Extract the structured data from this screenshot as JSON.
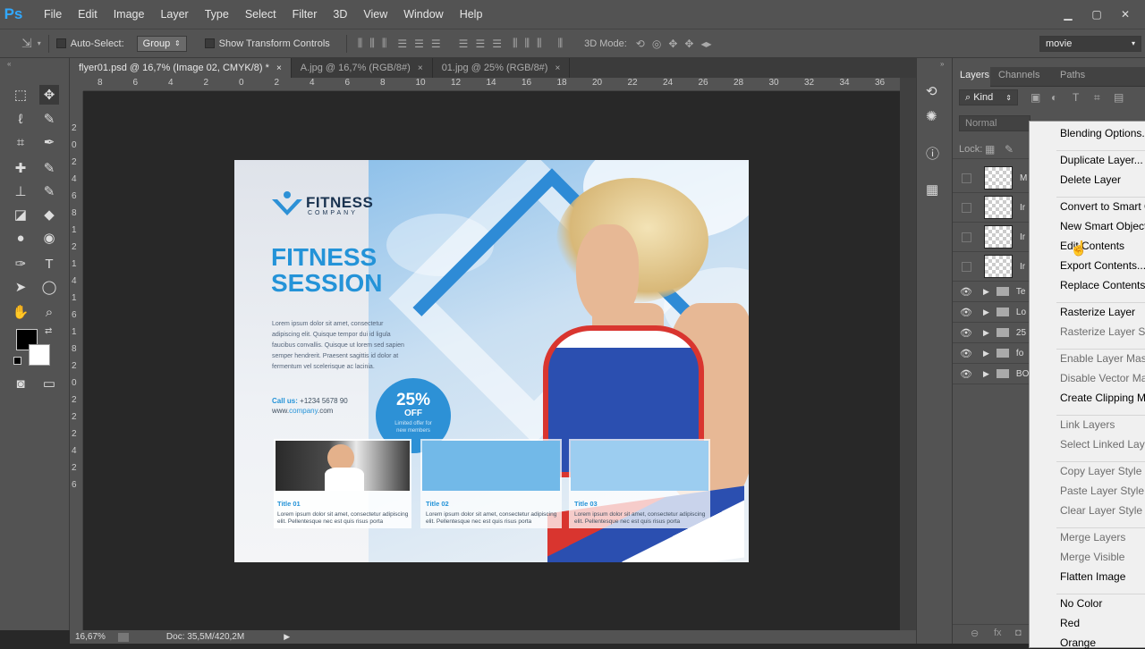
{
  "app": {
    "logo": "Ps"
  },
  "menu": [
    "File",
    "Edit",
    "Image",
    "Layer",
    "Type",
    "Select",
    "Filter",
    "3D",
    "View",
    "Window",
    "Help"
  ],
  "window_controls": {
    "minimize": "▁",
    "maximize": "▢",
    "close": "✕"
  },
  "options_bar": {
    "auto_select_label": "Auto-Select:",
    "auto_select_value": "Group",
    "show_transform_label": "Show Transform Controls",
    "mode_3d_label": "3D Mode:",
    "workspace_value": "movie"
  },
  "tabs": [
    {
      "label": "flyer01.psd @ 16,7% (Image 02, CMYK/8) *",
      "close": "×"
    },
    {
      "label": "A.jpg @ 16,7% (RGB/8#)",
      "close": "×"
    },
    {
      "label": "01.jpg @ 25% (RGB/8#)",
      "close": "×"
    }
  ],
  "ruler_top": [
    "8",
    "6",
    "4",
    "2",
    "0",
    "2",
    "4",
    "6",
    "8",
    "10",
    "12",
    "14",
    "16",
    "18",
    "20",
    "22",
    "24",
    "26",
    "28",
    "30",
    "32",
    "34",
    "36"
  ],
  "ruler_left": [
    "2",
    "0",
    "2",
    "4",
    "6",
    "8",
    "1",
    "2",
    "1",
    "4",
    "1",
    "6",
    "1",
    "8",
    "2",
    "0",
    "2",
    "2",
    "2",
    "4",
    "2",
    "6"
  ],
  "status": {
    "zoom": "16,67%",
    "doc": "Doc: 35,5M/420,2M"
  },
  "flyer": {
    "logo_name": "FITNESS",
    "logo_sub": "COMPANY",
    "headline_1": "FITNESS",
    "headline_2": "SESSION",
    "body": "Lorem ipsum dolor sit amet, consectetur adipiscing elit. Quisque tempor dui id ligula faucibus convallis. Quisque ut lorem sed sapien semper hendrerit. Praesent sagittis id dolor at fermentum vel scelerisque ac lacinia.",
    "call_label": "Call us:",
    "phone": "+1234 5678 90",
    "website_pre": "www.",
    "website_brand": "company",
    "website_post": ".com",
    "badge_value": "25%",
    "badge_off": "OFF",
    "badge_sub_1": "Limited offer for",
    "badge_sub_2": "new members",
    "cards": [
      {
        "title": "Title 01",
        "text": "Lorem ipsum dolor sit amet, consectetur adipiscing elit. Pellentesque nec est quis risus porta"
      },
      {
        "title": "Title 02",
        "text": "Lorem ipsum dolor sit amet, consectetur adipiscing elit. Pellentesque nec est quis risus porta"
      },
      {
        "title": "Title 03",
        "text": "Lorem ipsum dolor sit amet, consectetur adipiscing elit. Pellentesque nec est quis risus porta"
      }
    ]
  },
  "layers_panel": {
    "tabs": [
      "Layers",
      "Channels",
      "Paths"
    ],
    "kind": "Kind",
    "blend": "Normal",
    "lock_label": "Lock:",
    "layers": [
      {
        "name": "M",
        "visible": false,
        "type": "smart"
      },
      {
        "name": "Ir",
        "visible": false,
        "type": "smart"
      },
      {
        "name": "Ir",
        "visible": false,
        "type": "smart"
      },
      {
        "name": "Ir",
        "visible": false,
        "type": "smart"
      },
      {
        "name": "Te",
        "visible": true,
        "type": "group"
      },
      {
        "name": "Lo",
        "visible": true,
        "type": "group"
      },
      {
        "name": "25",
        "visible": true,
        "type": "group"
      },
      {
        "name": "fo",
        "visible": true,
        "type": "group"
      },
      {
        "name": "BO",
        "visible": true,
        "type": "group"
      }
    ]
  },
  "context_menu": [
    {
      "label": "Blending Options...",
      "disabled": false
    },
    {
      "sep": true
    },
    {
      "label": "Duplicate Layer...",
      "disabled": false
    },
    {
      "label": "Delete Layer",
      "disabled": false
    },
    {
      "sep": true
    },
    {
      "label": "Convert to Smart Object",
      "disabled": false
    },
    {
      "label": "New Smart Object via Copy",
      "disabled": false
    },
    {
      "label": "Edit Contents",
      "disabled": false
    },
    {
      "label": "Export Contents...",
      "disabled": false
    },
    {
      "label": "Replace Contents...",
      "disabled": false
    },
    {
      "sep": true
    },
    {
      "label": "Rasterize Layer",
      "disabled": false
    },
    {
      "label": "Rasterize Layer Style",
      "disabled": true
    },
    {
      "sep": true
    },
    {
      "label": "Enable Layer Mask",
      "disabled": true
    },
    {
      "label": "Disable Vector Mask",
      "disabled": true
    },
    {
      "label": "Create Clipping Mask",
      "disabled": false
    },
    {
      "sep": true
    },
    {
      "label": "Link Layers",
      "disabled": true
    },
    {
      "label": "Select Linked Layers",
      "disabled": true
    },
    {
      "sep": true
    },
    {
      "label": "Copy Layer Style",
      "disabled": true
    },
    {
      "label": "Paste Layer Style",
      "disabled": true
    },
    {
      "label": "Clear Layer Style",
      "disabled": true
    },
    {
      "sep": true
    },
    {
      "label": "Merge Layers",
      "disabled": true
    },
    {
      "label": "Merge Visible",
      "disabled": true
    },
    {
      "label": "Flatten Image",
      "disabled": false
    },
    {
      "sep": true
    },
    {
      "label": "No Color",
      "disabled": false
    },
    {
      "label": "Red",
      "disabled": false
    },
    {
      "label": "Orange",
      "disabled": false
    }
  ]
}
